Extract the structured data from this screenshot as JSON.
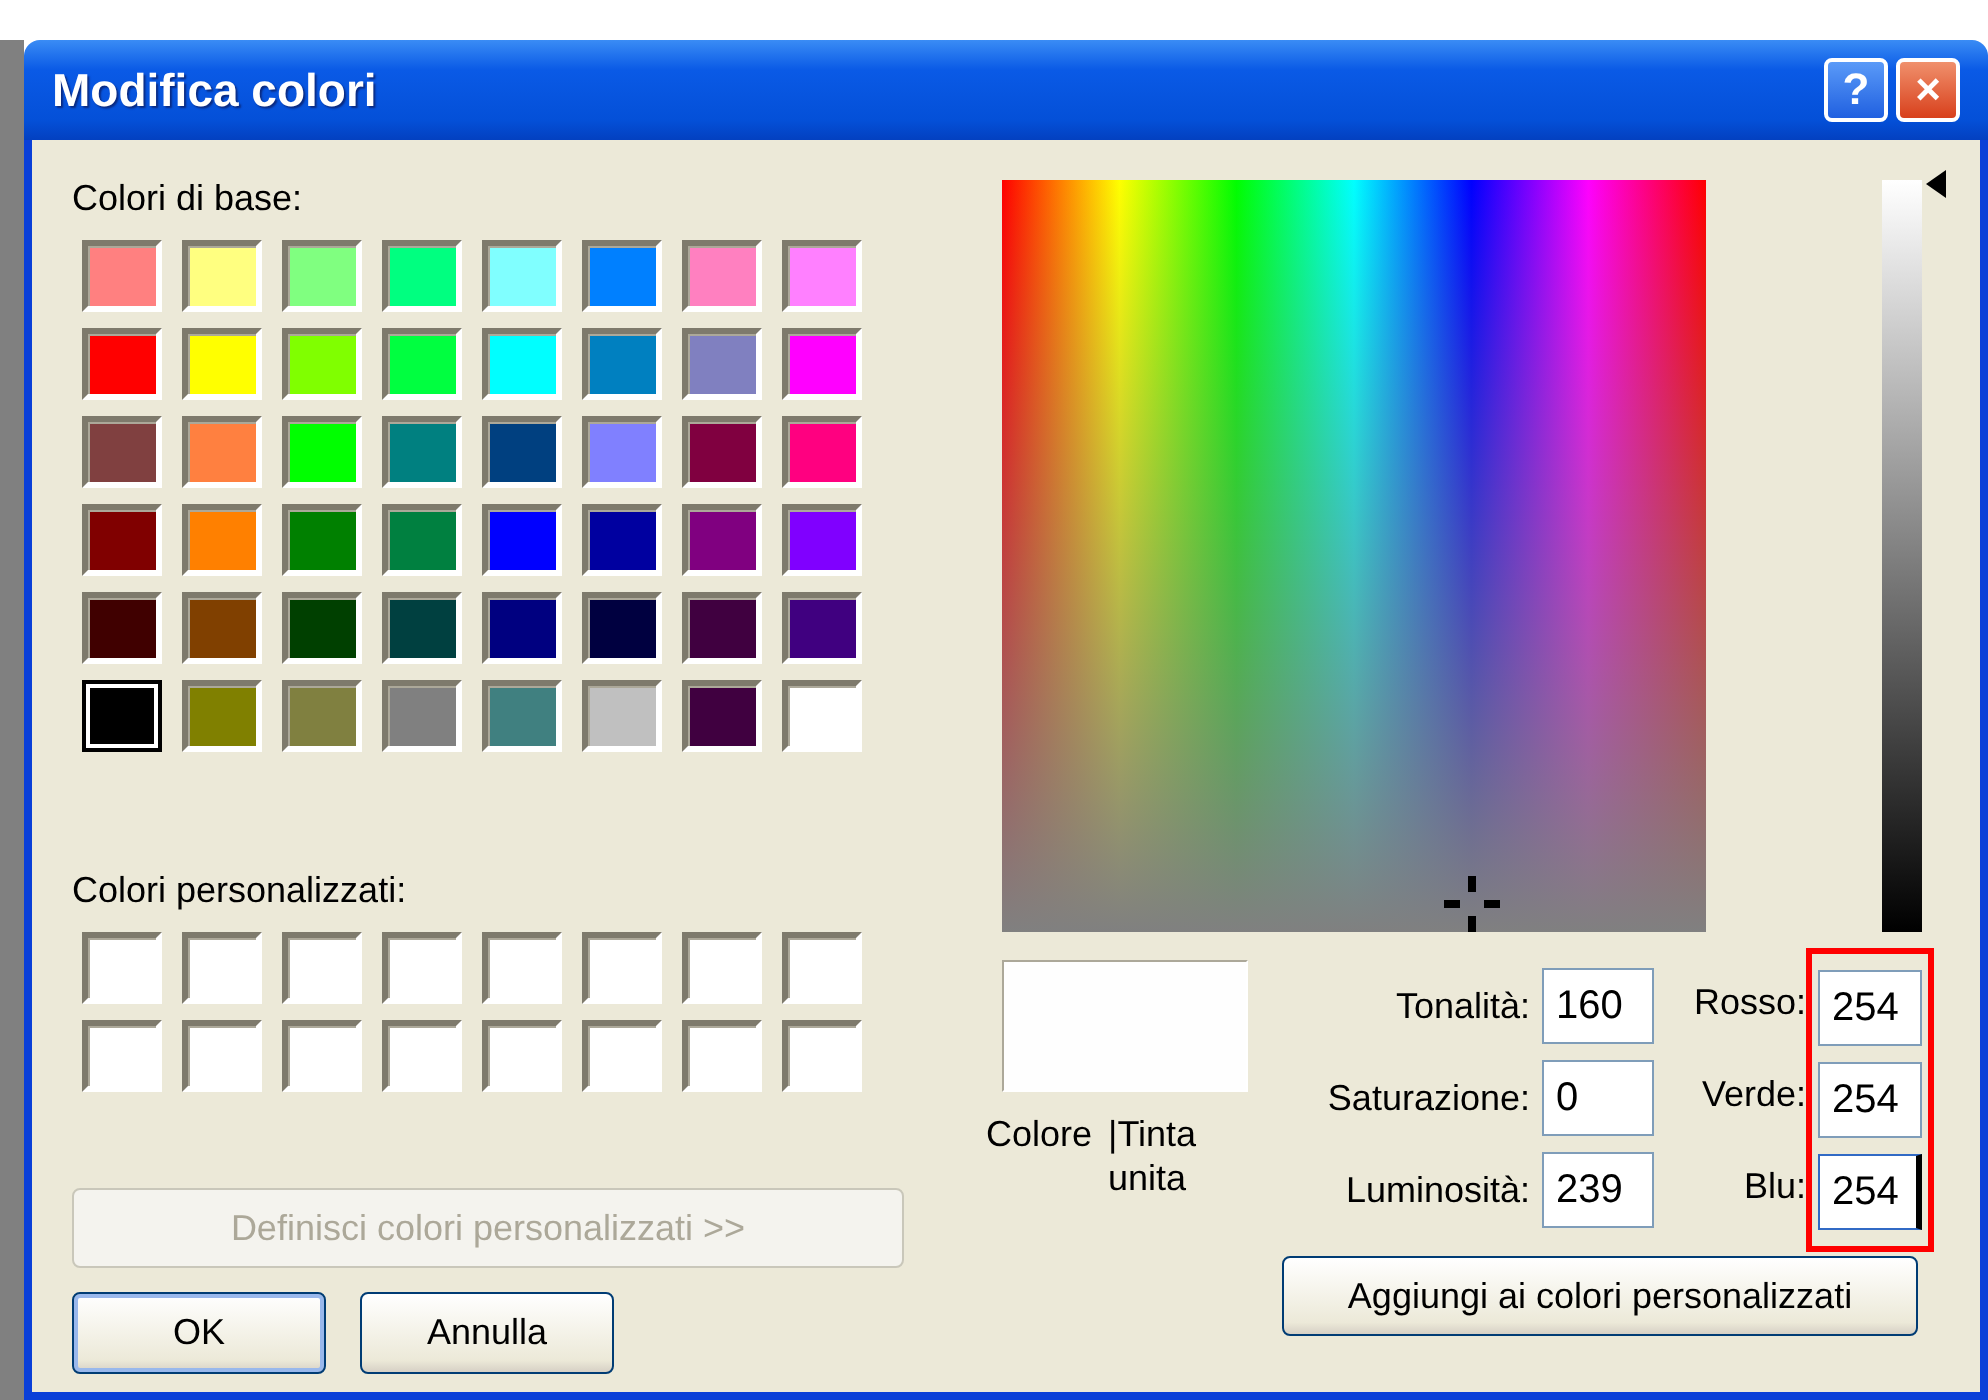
{
  "window": {
    "title": "Modifica colori",
    "help_button": "?",
    "close_button": "×"
  },
  "basic_colors": {
    "label": "Colori di base:",
    "swatches": [
      {
        "color": "#ff8080",
        "selected": false
      },
      {
        "color": "#ffff80",
        "selected": false
      },
      {
        "color": "#80ff80",
        "selected": false
      },
      {
        "color": "#00ff80",
        "selected": false
      },
      {
        "color": "#80ffff",
        "selected": false
      },
      {
        "color": "#0080ff",
        "selected": false
      },
      {
        "color": "#ff80c0",
        "selected": false
      },
      {
        "color": "#ff80ff",
        "selected": false
      },
      {
        "color": "#ff0000",
        "selected": false
      },
      {
        "color": "#ffff00",
        "selected": false
      },
      {
        "color": "#80ff00",
        "selected": false
      },
      {
        "color": "#00ff40",
        "selected": false
      },
      {
        "color": "#00ffff",
        "selected": false
      },
      {
        "color": "#0080c0",
        "selected": false
      },
      {
        "color": "#8080c0",
        "selected": false
      },
      {
        "color": "#ff00ff",
        "selected": false
      },
      {
        "color": "#804040",
        "selected": false
      },
      {
        "color": "#ff8040",
        "selected": false
      },
      {
        "color": "#00ff00",
        "selected": false
      },
      {
        "color": "#008080",
        "selected": false
      },
      {
        "color": "#004080",
        "selected": false
      },
      {
        "color": "#8080ff",
        "selected": false
      },
      {
        "color": "#800040",
        "selected": false
      },
      {
        "color": "#ff0080",
        "selected": false
      },
      {
        "color": "#800000",
        "selected": false
      },
      {
        "color": "#ff8000",
        "selected": false
      },
      {
        "color": "#008000",
        "selected": false
      },
      {
        "color": "#008040",
        "selected": false
      },
      {
        "color": "#0000ff",
        "selected": false
      },
      {
        "color": "#0000a0",
        "selected": false
      },
      {
        "color": "#800080",
        "selected": false
      },
      {
        "color": "#8000ff",
        "selected": false
      },
      {
        "color": "#400000",
        "selected": false
      },
      {
        "color": "#804000",
        "selected": false
      },
      {
        "color": "#004000",
        "selected": false
      },
      {
        "color": "#004040",
        "selected": false
      },
      {
        "color": "#000080",
        "selected": false
      },
      {
        "color": "#000040",
        "selected": false
      },
      {
        "color": "#400040",
        "selected": false
      },
      {
        "color": "#400080",
        "selected": false
      },
      {
        "color": "#000000",
        "selected": true
      },
      {
        "color": "#808000",
        "selected": false
      },
      {
        "color": "#808040",
        "selected": false
      },
      {
        "color": "#808080",
        "selected": false
      },
      {
        "color": "#408080",
        "selected": false
      },
      {
        "color": "#c0c0c0",
        "selected": false
      },
      {
        "color": "#400040",
        "selected": false
      },
      {
        "color": "#ffffff",
        "selected": false
      }
    ]
  },
  "custom_colors": {
    "label": "Colori personalizzati:",
    "swatches": [
      {
        "color": "#ffffff"
      },
      {
        "color": "#ffffff"
      },
      {
        "color": "#ffffff"
      },
      {
        "color": "#ffffff"
      },
      {
        "color": "#ffffff"
      },
      {
        "color": "#ffffff"
      },
      {
        "color": "#ffffff"
      },
      {
        "color": "#ffffff"
      },
      {
        "color": "#ffffff"
      },
      {
        "color": "#ffffff"
      },
      {
        "color": "#ffffff"
      },
      {
        "color": "#ffffff"
      },
      {
        "color": "#ffffff"
      },
      {
        "color": "#ffffff"
      },
      {
        "color": "#ffffff"
      },
      {
        "color": "#ffffff"
      }
    ]
  },
  "define_button": {
    "label": "Definisci colori personalizzati >>",
    "disabled": true
  },
  "buttons": [
    {
      "label": "OK",
      "default": true
    },
    {
      "label": "Annulla",
      "default": false
    }
  ],
  "luminance_slider": {
    "level": 0.996
  },
  "preview": {
    "color": "#fefefe",
    "labels": [
      "Colore",
      "|Tinta unita"
    ]
  },
  "hsl_fields": [
    {
      "label": "Tonalità:",
      "value": "160"
    },
    {
      "label": "Saturazione:",
      "value": "0"
    },
    {
      "label": "Luminosità:",
      "value": "239"
    }
  ],
  "rgb_fields": {
    "highlighted": true,
    "items": [
      {
        "label": "Rosso:",
        "value": "254",
        "focused": false
      },
      {
        "label": "Verde:",
        "value": "254",
        "focused": false
      },
      {
        "label": "Blu:",
        "value": "254",
        "focused": true
      }
    ]
  },
  "add_button": {
    "label": "Aggiungi ai colori personalizzati"
  }
}
